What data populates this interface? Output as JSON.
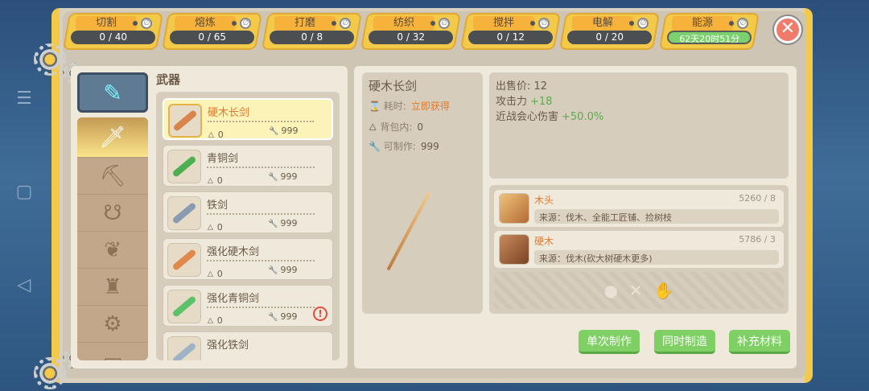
{
  "tabs": [
    {
      "label": "切割",
      "progress": "0 / 40"
    },
    {
      "label": "熔炼",
      "progress": "0 / 65"
    },
    {
      "label": "打磨",
      "progress": "0 / 8"
    },
    {
      "label": "纺织",
      "progress": "0 / 32"
    },
    {
      "label": "搅拌",
      "progress": "0 / 12"
    },
    {
      "label": "电解",
      "progress": "0 / 20"
    },
    {
      "label": "能源",
      "progress": "62天20时51分"
    }
  ],
  "close_glyph": "✕",
  "list": {
    "title": "武器",
    "items": [
      {
        "name": "硬木长剑",
        "owned": "0",
        "max": "999",
        "color": "#d9844a"
      },
      {
        "name": "青铜剑",
        "owned": "0",
        "max": "999",
        "color": "#4caf50"
      },
      {
        "name": "铁剑",
        "owned": "0",
        "max": "999",
        "color": "#8a9bb0"
      },
      {
        "name": "强化硬木剑",
        "owned": "0",
        "max": "999",
        "color": "#e0894a"
      },
      {
        "name": "强化青铜剑",
        "owned": "0",
        "max": "999",
        "color": "#5cc26a"
      },
      {
        "name": "强化铁剑",
        "owned": "",
        "max": "",
        "color": "#9fb2c6"
      }
    ]
  },
  "detail": {
    "name": "硬木长剑",
    "time_label": "耗时:",
    "time_value": "立即获得",
    "bag_label": "背包内:",
    "bag_value": "0",
    "craftable_label": "可制作:",
    "craftable_value": "999"
  },
  "stats": {
    "price_label": "出售价:",
    "price_value": "12",
    "attack_label": "攻击力",
    "attack_value": "+18",
    "crit_label": "近战会心伤害",
    "crit_value": "+50.0%"
  },
  "materials": [
    {
      "name": "木头",
      "count": "5260 / 8",
      "source": "来源：伐木、全能工匠铺、捡树枝"
    },
    {
      "name": "硬木",
      "count": "5786 / 3",
      "source": "来源：伐木(砍大树硬木更多)"
    }
  ],
  "buttons": {
    "single": "单次制作",
    "batch": "同时制造",
    "refill": "补充材料"
  }
}
